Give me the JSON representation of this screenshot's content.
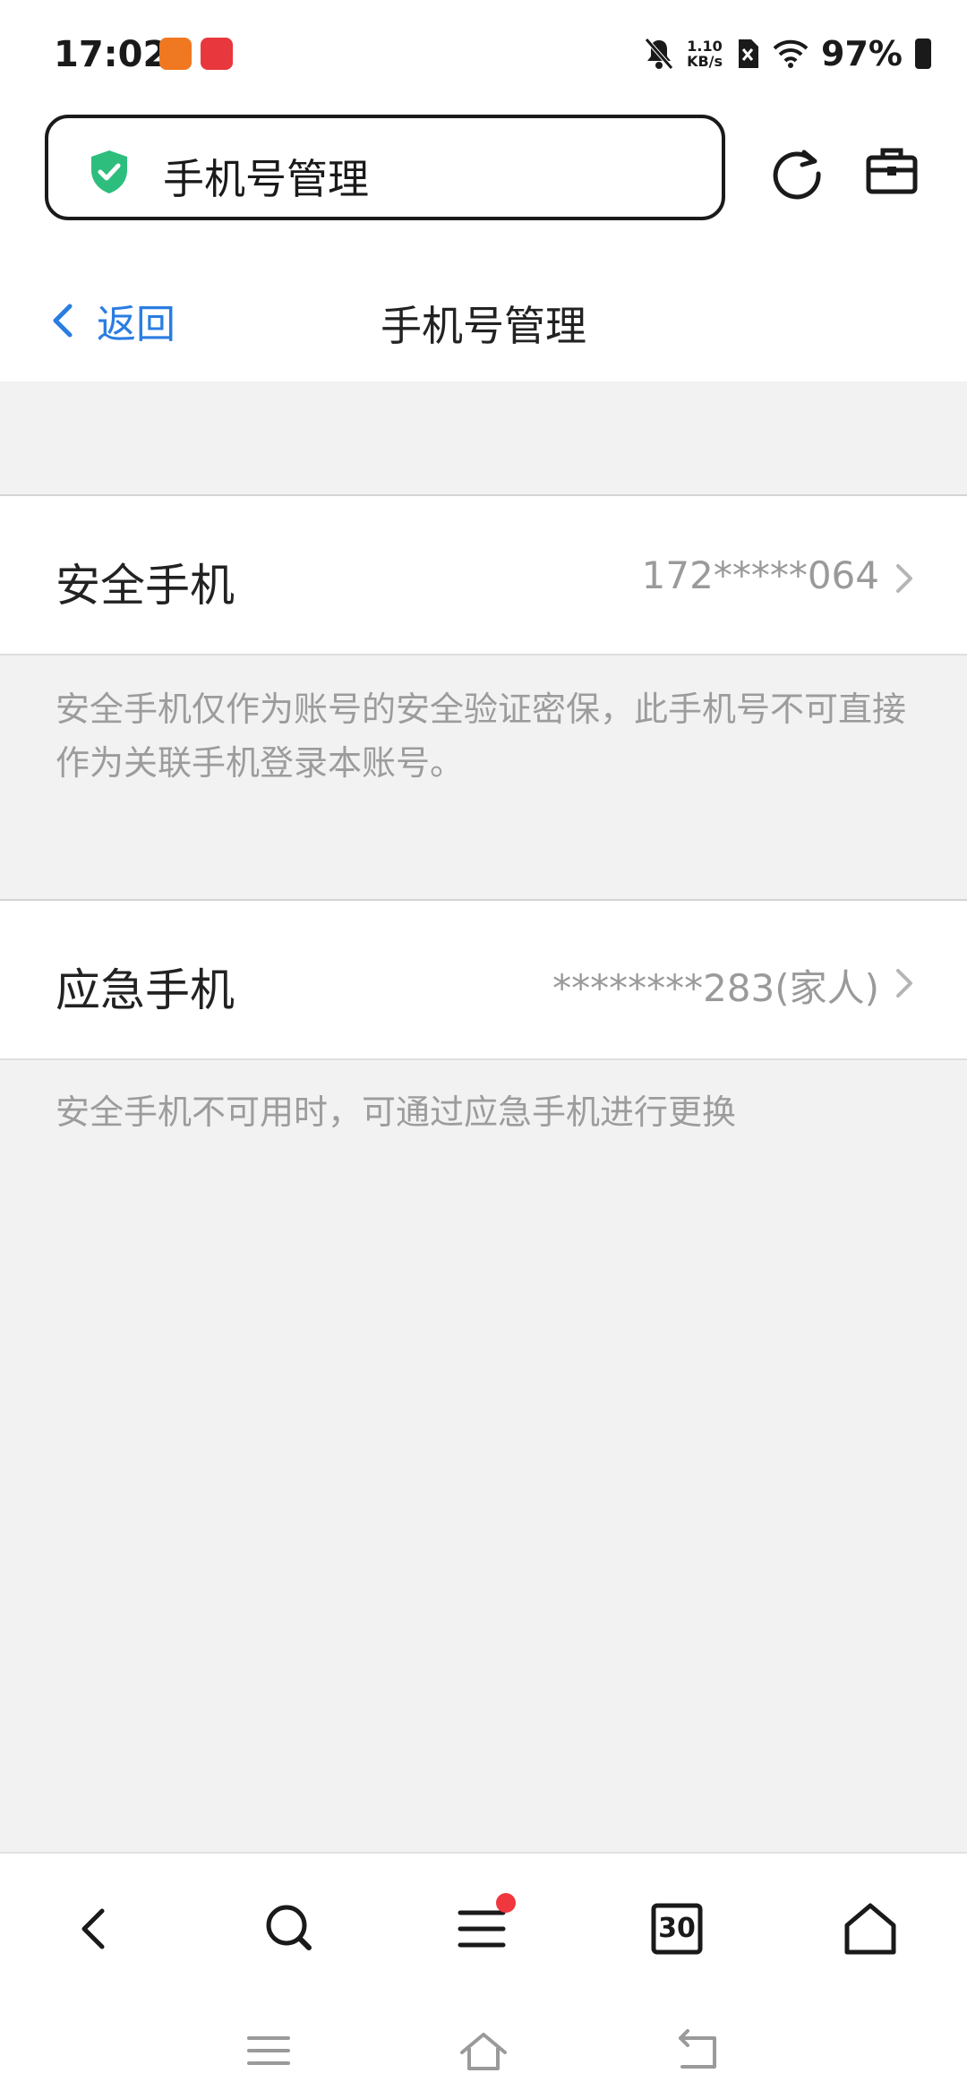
{
  "status_bar": {
    "time": "17:02",
    "net_speed_value": "1.10",
    "net_speed_unit": "KB/s",
    "battery": "97%"
  },
  "browser": {
    "page_title": "手机号管理",
    "icons": [
      "shield-check-icon",
      "reload-icon",
      "toolbox-icon"
    ]
  },
  "header": {
    "back_label": "返回",
    "title": "手机号管理"
  },
  "rows": [
    {
      "label": "安全手机",
      "value": "172*****064",
      "description": "安全手机仅作为账号的安全验证密保，此手机号不可直接作为关联手机登录本账号。"
    },
    {
      "label": "应急手机",
      "value": "********283(家人)",
      "description": "安全手机不可用时，可通过应急手机进行更换"
    }
  ],
  "toolbar": {
    "tabs_count": "30",
    "icons": [
      "back-icon",
      "search-icon",
      "menu-icon",
      "tabs-icon",
      "home-icon"
    ],
    "menu_badge_color": "#f0373d"
  },
  "colors": {
    "accent": "#2a7de1",
    "shield": "#2dbe7e"
  }
}
